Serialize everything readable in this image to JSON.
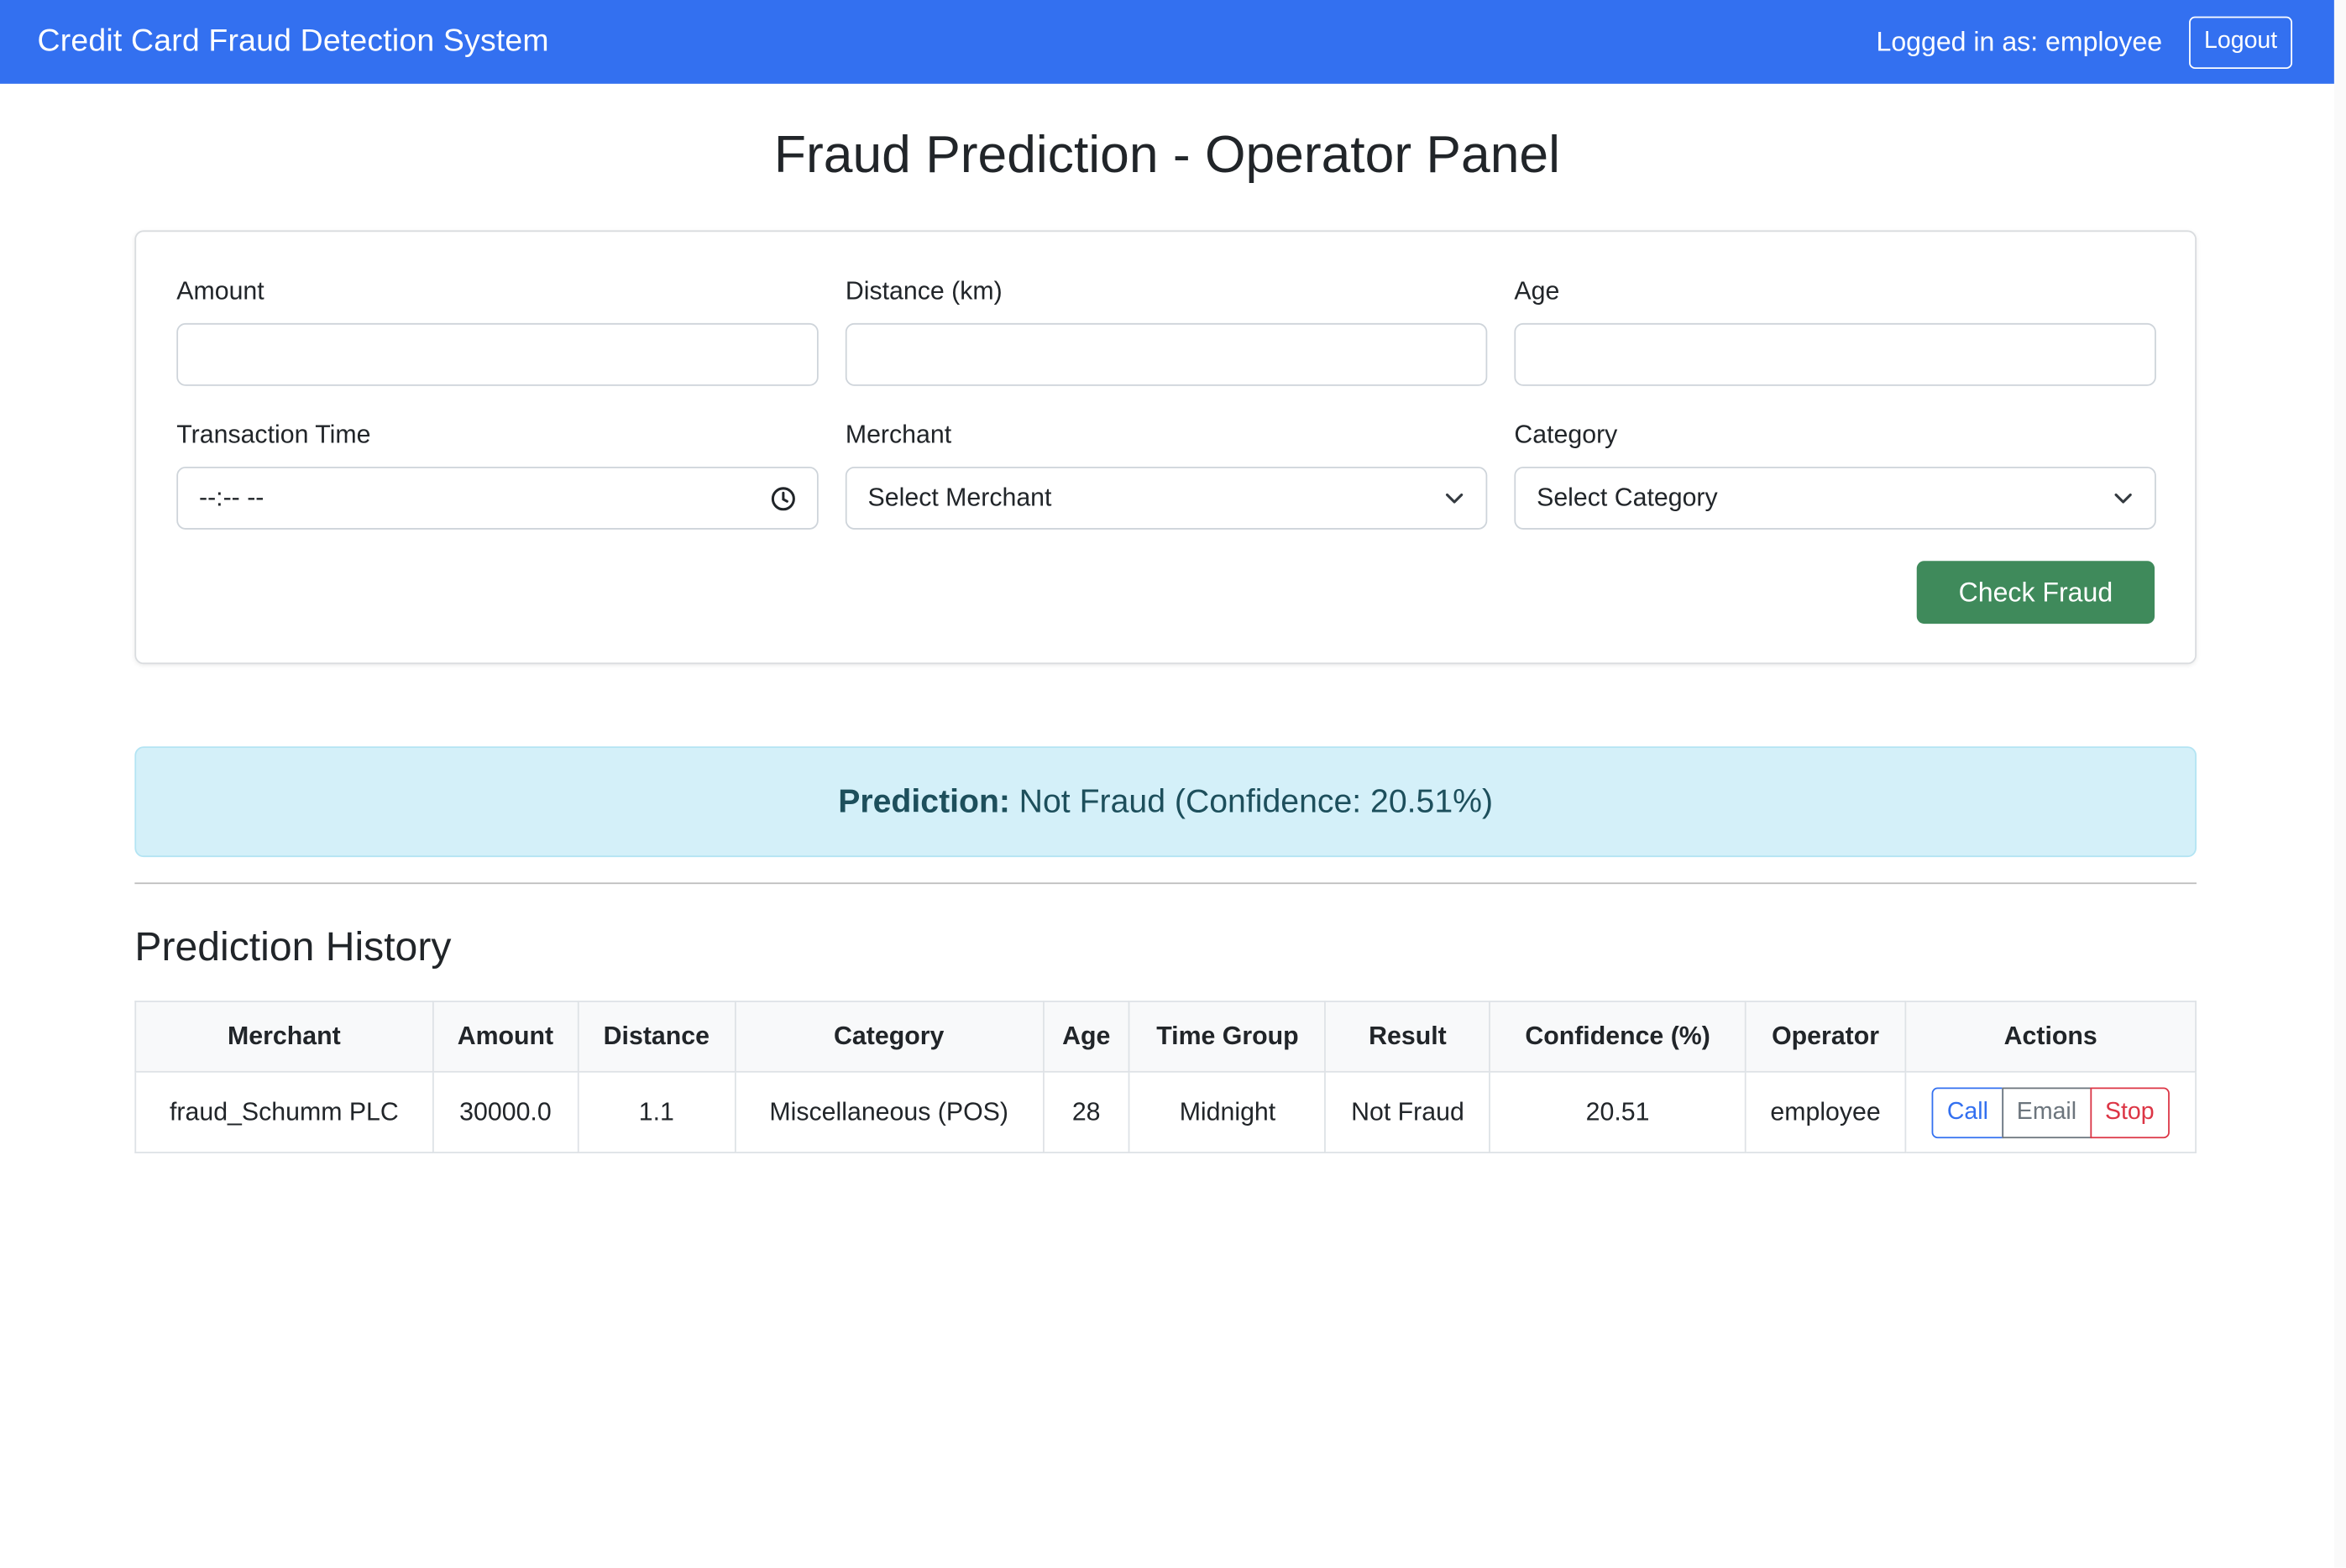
{
  "navbar": {
    "brand": "Credit Card Fraud Detection System",
    "logged_in": "Logged in as: employee",
    "logout_label": "Logout",
    "color": "#3370f0"
  },
  "page": {
    "title": "Fraud Prediction - Operator Panel"
  },
  "form": {
    "amount_label": "Amount",
    "amount_value": "",
    "distance_label": "Distance (km)",
    "distance_value": "",
    "age_label": "Age",
    "age_value": "",
    "time_label": "Transaction Time",
    "time_placeholder": "--:-- --",
    "merchant_label": "Merchant",
    "merchant_selected": "Select Merchant",
    "category_label": "Category",
    "category_selected": "Select Category",
    "submit_label": "Check Fraud",
    "submit_color": "#3f8a5b"
  },
  "prediction": {
    "label": "Prediction:",
    "text": "Not Fraud (Confidence: 20.51%)"
  },
  "history": {
    "title": "Prediction History",
    "columns": [
      "Merchant",
      "Amount",
      "Distance",
      "Category",
      "Age",
      "Time Group",
      "Result",
      "Confidence (%)",
      "Operator",
      "Actions"
    ],
    "rows": [
      {
        "merchant": "fraud_Schumm PLC",
        "amount": "30000.0",
        "distance": "1.1",
        "category": "Miscellaneous (POS)",
        "age": "28",
        "time_group": "Midnight",
        "result": "Not Fraud",
        "confidence": "20.51",
        "operator": "employee",
        "actions": {
          "call": "Call",
          "email": "Email",
          "stop": "Stop"
        }
      }
    ]
  },
  "icons": {
    "time": "clock-icon",
    "dropdown": "chevron-down-icon"
  }
}
